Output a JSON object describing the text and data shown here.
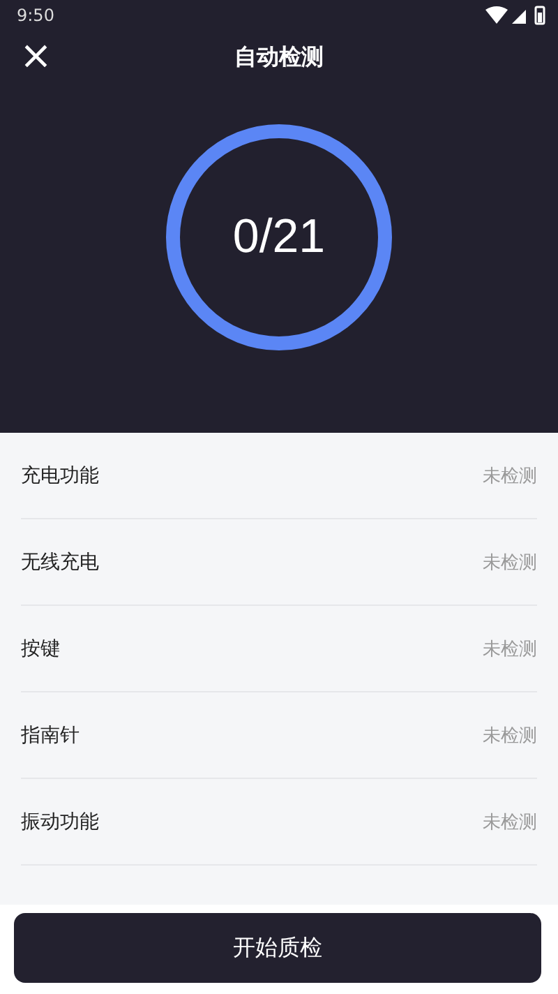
{
  "status_bar": {
    "time": "9:50"
  },
  "header": {
    "title": "自动检测",
    "close": "×"
  },
  "progress": {
    "text": "0/21"
  },
  "items": [
    {
      "name": "充电功能",
      "status": "未检测"
    },
    {
      "name": "无线充电",
      "status": "未检测"
    },
    {
      "name": "按键",
      "status": "未检测"
    },
    {
      "name": "指南针",
      "status": "未检测"
    },
    {
      "name": "振动功能",
      "status": "未检测"
    }
  ],
  "button": "开始质检"
}
